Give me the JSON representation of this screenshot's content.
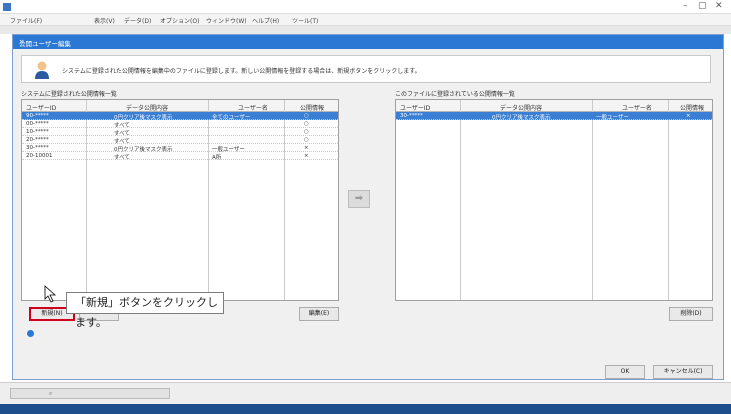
{
  "app": {
    "title": "",
    "menu": [
      "ファイル(F)",
      "",
      "表示(V)",
      "データ(D)",
      "オプション(O)",
      "ウィンドウ(W)",
      "ヘルプ(H)",
      "ツール(T)"
    ]
  },
  "dialog": {
    "title": "公開ユーザー編集",
    "info_text": "システムに登録された公開情報を編集中のファイルに登録します。新しい公開情報を登録する場合は、新規ボタンをクリックします。",
    "left_label": "システムに登録された公開情報一覧",
    "right_label": "このファイルに登録されている公開情報一覧",
    "columns": [
      "ユーザーID",
      "データ公開内容",
      "ユーザー名",
      "公開情報"
    ],
    "left_rows": [
      {
        "id": "90-*****",
        "content": "0円クリア後マスク表示",
        "user": "全てのユーザー",
        "flag": "○"
      },
      {
        "id": "00-*****",
        "content": "すべて",
        "user": "",
        "flag": "○"
      },
      {
        "id": "10-*****",
        "content": "すべて",
        "user": "",
        "flag": "○"
      },
      {
        "id": "20-*****",
        "content": "すべて",
        "user": "",
        "flag": "○"
      },
      {
        "id": "30-*****",
        "content": "0円クリア後マスク表示",
        "user": "一般ユーザー",
        "flag": "×"
      },
      {
        "id": "20-10001",
        "content": "すべて",
        "user": "A所",
        "flag": "×"
      }
    ],
    "right_rows": [
      {
        "id": "30-*****",
        "content": "0円クリア後マスク表示",
        "user": "一般ユーザー",
        "flag": "×"
      }
    ],
    "buttons": {
      "new": "新規(N)",
      "edit": "",
      "edit_right": "編集(E)",
      "delete": "削除(D)",
      "ok": "OK",
      "cancel": "キャンセル(C)"
    },
    "note_lines": [
      "",
      "",
      ""
    ]
  },
  "callout": "「新規」ボタンをクリックします。",
  "statusbar": {
    "search_placeholder": "",
    "right_info": ""
  },
  "colors": {
    "titlebar": "#2b78d4",
    "selected_row": "#3b7fd4",
    "highlight_border": "#d0021b"
  }
}
